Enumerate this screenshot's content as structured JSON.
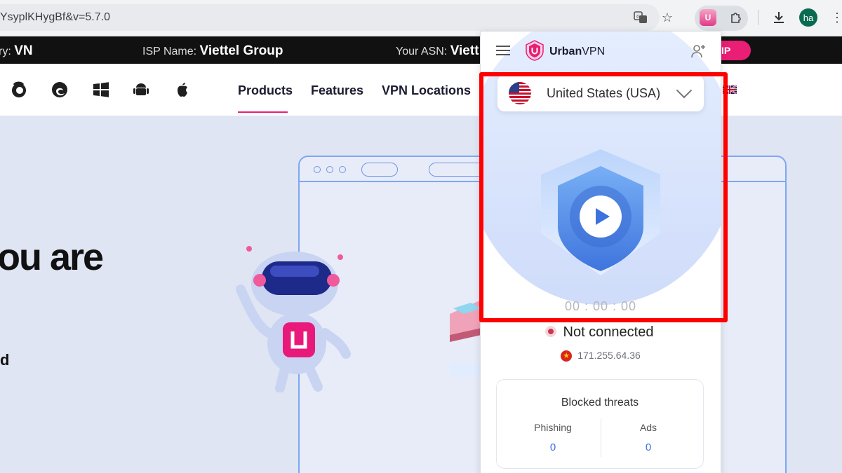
{
  "browser": {
    "url": "YsyplKHygBf&v=5.7.0",
    "avatar_initials": "ha",
    "extension_letter": "U"
  },
  "infobar": {
    "country_label": "ry:",
    "country_value": "VN",
    "isp_label": "ISP Name:",
    "isp_value": "Viettel Group",
    "asn_label": "Your ASN:",
    "asn_value": "Viett",
    "button_partial": "IP"
  },
  "site_nav": {
    "os_icons": [
      "firefox-icon",
      "edge-icon",
      "windows-icon",
      "android-icon",
      "apple-icon"
    ],
    "links": [
      "Products",
      "Features",
      "VPN Locations"
    ],
    "active": "Products"
  },
  "hero": {
    "headline_partial": "ou are",
    "line_partial": "d"
  },
  "popup": {
    "brand_bold": "Urban",
    "brand_regular": "VPN",
    "country": "United States (USA)",
    "timer": "00 : 00 : 00",
    "status": "Not connected",
    "ip": "171.255.64.36",
    "threats": {
      "title": "Blocked threats",
      "phishing_label": "Phishing",
      "phishing_value": "0",
      "ads_label": "Ads",
      "ads_value": "0"
    }
  },
  "colors": {
    "accent_pink": "#e91e75",
    "highlight_red": "#ff0000",
    "shield_blue": "#4f86e6"
  }
}
